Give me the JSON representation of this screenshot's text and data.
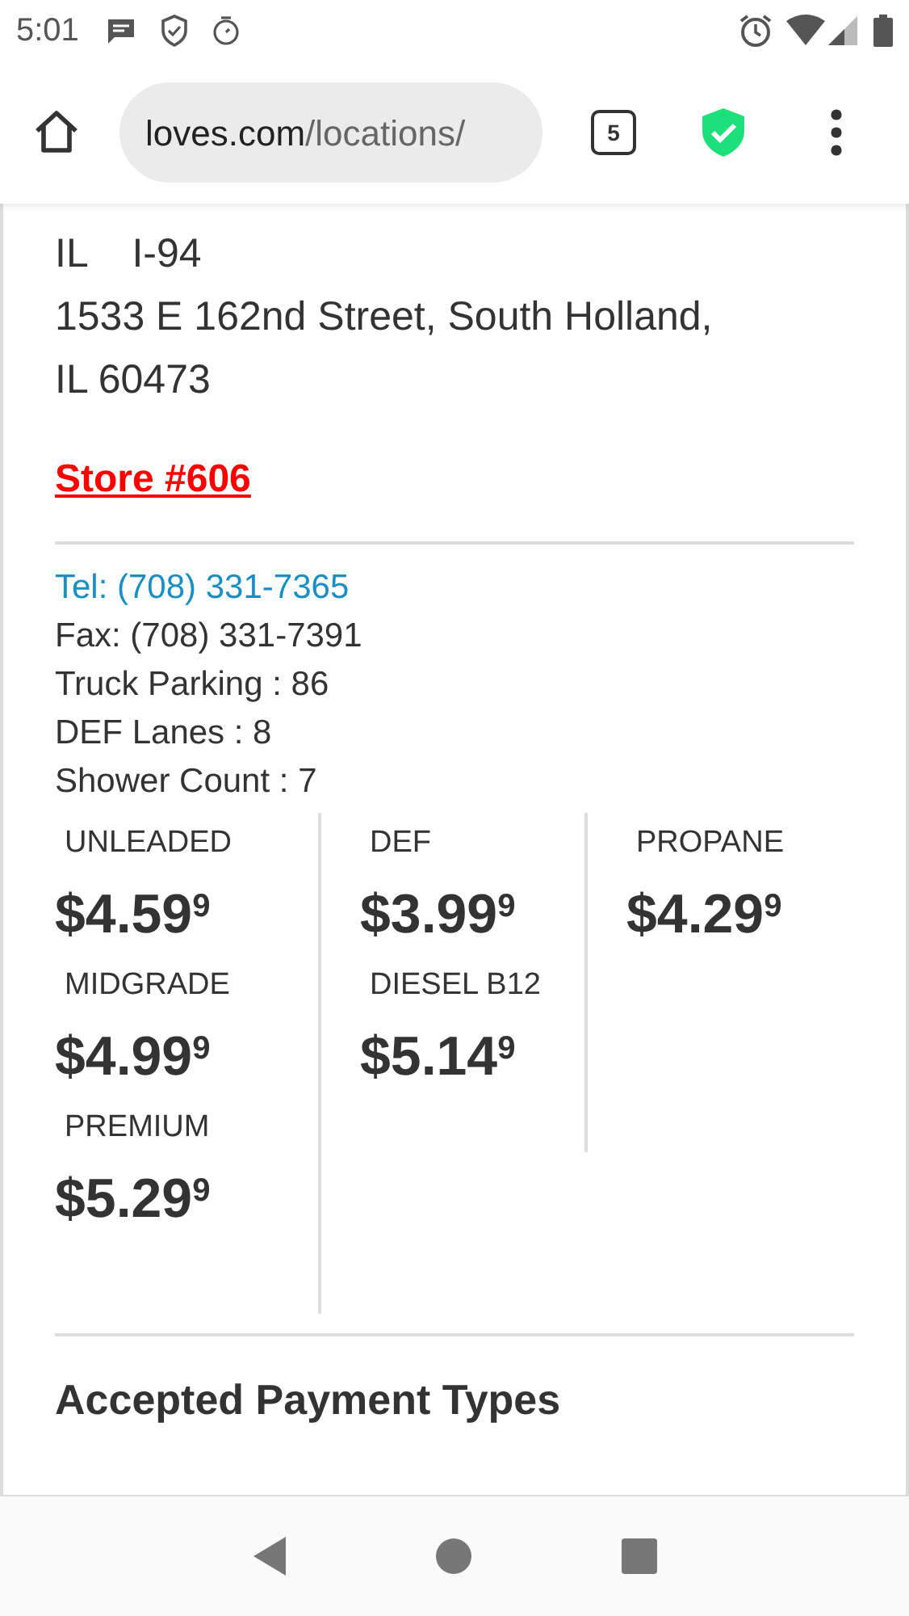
{
  "status_bar": {
    "time": "5:01"
  },
  "browser": {
    "url_host": "loves.com",
    "url_path": "/locations/",
    "tab_count": "5"
  },
  "location": {
    "address_lines": [
      "IL    I-94",
      "1533 E 162nd Street, South Holland,",
      "IL 60473"
    ],
    "store_link": "Store #606",
    "phone": "Tel: (708) 331-7365",
    "details": [
      "Fax: (708) 331-7391",
      "Truck Parking : 86",
      "DEF Lanes : 8",
      "Shower Count : 7"
    ]
  },
  "fuel_columns": [
    [
      {
        "name": "UNLEADED",
        "price": "$4.59$^{9}$"
      },
      {
        "name": "MIDGRADE",
        "price": "$4.99$^{9}$"
      },
      {
        "name": "PREMIUM",
        "price": "$5.29$^{9}$"
      }
    ],
    [
      {
        "name": "DEF",
        "price": "$3.99$^{9}$"
      },
      {
        "name": "DIESEL B12",
        "price": "$5.14$^{9}$"
      }
    ],
    [
      {
        "name": "PROPANE",
        "price": "$4.29$^{9}$"
      }
    ]
  ],
  "section_heading": "Accepted Payment Types"
}
